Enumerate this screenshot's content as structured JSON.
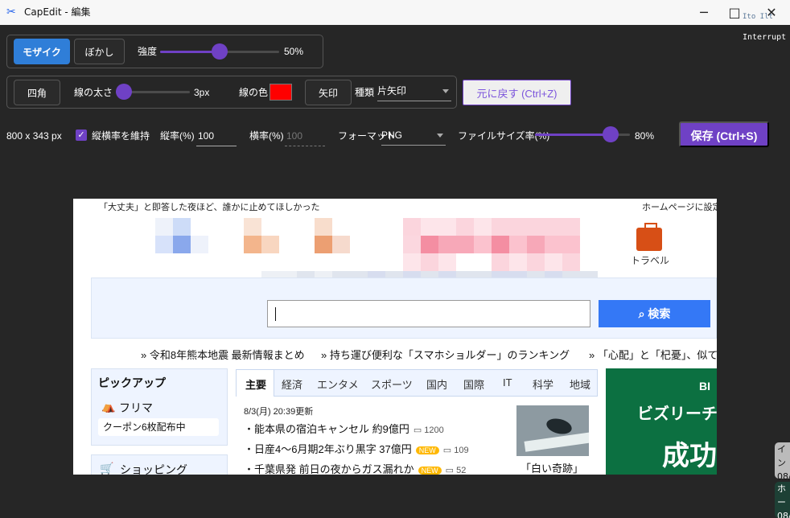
{
  "window": {
    "title": "CapEdit - 編集",
    "minimize": "─",
    "maximize": "□",
    "close": "✕"
  },
  "terminal": {
    "faint": "Ito Ilt",
    "text": "Interrupt"
  },
  "toolbar": {
    "mosaic": "モザイク",
    "blur": "ぼかし",
    "strength_label": "強度",
    "strength_value": "50%",
    "strength_fraction": 0.5,
    "rect": "四角",
    "line_width_label": "線の太さ",
    "line_width_value": "3px",
    "line_width_fraction": 0.1,
    "line_color_label": "線の色",
    "line_color": "#ff0000",
    "arrow": "矢印",
    "type_label": "種類",
    "type_value": "片矢印",
    "undo": "元に戻す (Ctrl+Z)"
  },
  "options": {
    "size": "800 x 343 px",
    "keep_ratio": "縦横率を維持",
    "height_ratio_label": "縦率(%)",
    "height_ratio": "100",
    "width_ratio_label": "横率(%)",
    "width_ratio": "100",
    "format_label": "フォーマット",
    "format": "PNG",
    "file_size_label": "ファイルサイズ率(%)",
    "file_size_value": "80%",
    "file_size_fraction": 0.8,
    "save": "保存 (Ctrl+S)"
  },
  "preview": {
    "top_note": "「大丈夫」と即答した夜ほど、誰かに止めてほしかった",
    "home_link": "ホームページに設定",
    "travel": "トラベル",
    "search_button": "検索",
    "news": [
      "令和8年熊本地震 最新情報まとめ",
      "持ち運び便利な「スマホショルダー」のランキング",
      "「心配」と「杞憂」、似て"
    ],
    "pickup": "ピックアップ",
    "flea": "フリマ",
    "coupon": "クーポン6枚配布中",
    "shopping": "ショッピング",
    "tabs": [
      "主要",
      "経済",
      "エンタメ",
      "スポーツ",
      "国内",
      "国際",
      "IT",
      "科学",
      "地域"
    ],
    "date": "8/3(月) 20:39更新",
    "headlines": [
      {
        "text": "・能本県の宿泊キャンセル 約9億円",
        "new": "",
        "count": "1200"
      },
      {
        "text": "・日産4〜6月期2年ぶり黒字 37億円",
        "new": "NEW",
        "count": "109"
      },
      {
        "text": "・千葉県発 前日の夜からガス漏れか",
        "new": "NEW",
        "count": "52"
      }
    ],
    "photo_caption": "「白い奇跡」",
    "ad_b": "BI",
    "ad_headline": "ビズリーチ",
    "ad_big": "成功"
  },
  "edge": {
    "one": "イン",
    "one_date": "08/",
    "two": "ホー",
    "two_date": "08/"
  },
  "colors": {
    "accent": "#6f41c5",
    "primary": "#2f7ed8",
    "search": "#3478f6"
  }
}
